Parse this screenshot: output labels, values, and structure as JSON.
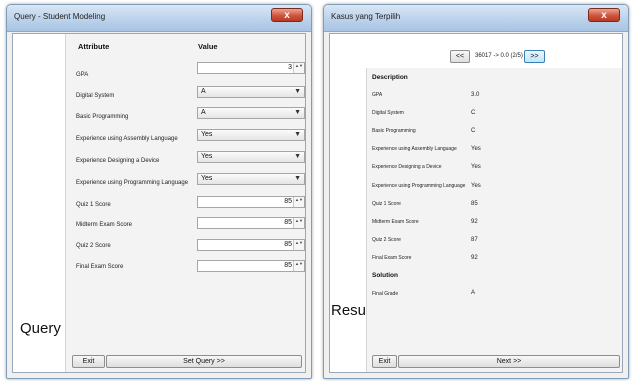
{
  "query": {
    "title": "Query - Student Modeling",
    "side_label": "Query",
    "header_attribute": "Attribute",
    "header_value": "Value",
    "rows": [
      {
        "label": "GPA",
        "value": "3"
      },
      {
        "label": "Digital System",
        "value": "A"
      },
      {
        "label": "Basic Programming",
        "value": "A"
      },
      {
        "label": "Experience using Assembly Language",
        "value": "Yes"
      },
      {
        "label": "Experience Designing a Device",
        "value": "Yes"
      },
      {
        "label": "Experience using Programming Language",
        "value": "Yes"
      },
      {
        "label": "Quiz 1 Score",
        "value": "85"
      },
      {
        "label": "Midterm Exam Score",
        "value": "85"
      },
      {
        "label": "Quiz 2 Score",
        "value": "85"
      },
      {
        "label": "Final Exam Score",
        "value": "85"
      }
    ],
    "exit_label": "Exit",
    "set_query_label": "Set Query >>"
  },
  "result": {
    "title": "Kasus yang Terpilih",
    "side_label": "Result",
    "prev_label": "<<",
    "nav_text": "36017 -> 0.0 (2/5)",
    "next_nav_label": ">>",
    "description_header": "Description",
    "rows": [
      {
        "label": "GPA",
        "value": "3.0"
      },
      {
        "label": "Digital System",
        "value": "C"
      },
      {
        "label": "Basic Programming",
        "value": "C"
      },
      {
        "label": "Experience using Assembly Language",
        "value": "Yes"
      },
      {
        "label": "Experience Designing a Device",
        "value": "Yes"
      },
      {
        "label": "Experience using Programming Language",
        "value": "Yes"
      },
      {
        "label": "Quiz 1 Score",
        "value": "85"
      },
      {
        "label": "Midterm Exam Score",
        "value": "92"
      },
      {
        "label": "Quiz 2 Score",
        "value": "87"
      },
      {
        "label": "Final Exam Score",
        "value": "92"
      }
    ],
    "solution_header": "Solution",
    "solution_label": "Final Grade",
    "solution_value": "A",
    "exit_label": "Exit",
    "next_label": "Next >>"
  },
  "close_glyph": "x",
  "spin_arrows": "▲▼",
  "dropdown_glyph": "▼"
}
